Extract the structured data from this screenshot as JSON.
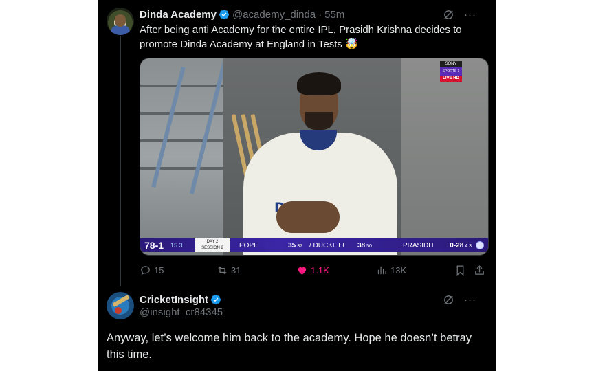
{
  "tweet1": {
    "author_name": "Dinda Academy",
    "handle": "@academy_dinda",
    "time": "55m",
    "text": "After being anti Academy for the entire IPL, Prasidh Krishna decides to promote Dinda Academy at England in Tests 🤯",
    "media": {
      "broadcaster": [
        "SONY",
        "SPORTS 1",
        "LIVE HD"
      ],
      "shirt_logo": "DREA  1",
      "scorebar": {
        "total": "78-1",
        "overs": "15.3",
        "day": "DAY 2",
        "session": "SESSION 2",
        "batter1": "POPE",
        "batter1_runs": "35",
        "batter1_balls": "37",
        "batter2": "/ DUCKETT",
        "batter2_runs": "38",
        "batter2_balls": "50",
        "bowler": "PRASIDH",
        "bowler_figures": "0-28",
        "bowler_overs": "4.3"
      }
    },
    "stats": {
      "replies": "15",
      "reposts": "31",
      "likes": "1.1K",
      "views": "13K"
    }
  },
  "tweet2": {
    "author_name": "CricketInsight",
    "handle": "@insight_cr84345",
    "text": "Anyway, let’s welcome him back to the academy. Hope he doesn’t betray this time."
  },
  "colors": {
    "background": "#000000",
    "text": "#e7e9ea",
    "muted": "#71767b",
    "verified": "#1d9bf0",
    "like": "#f91880"
  },
  "icons": [
    "verified-badge-icon",
    "grok-icon",
    "more-icon",
    "reply-icon",
    "repost-icon",
    "like-icon",
    "views-icon",
    "bookmark-icon",
    "share-icon"
  ]
}
